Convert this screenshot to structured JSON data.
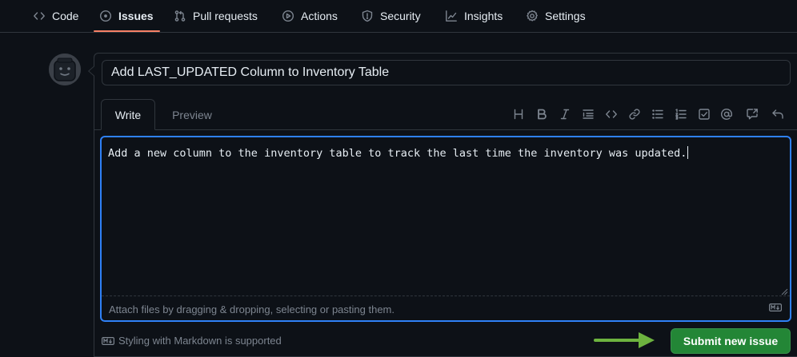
{
  "nav": {
    "items": [
      {
        "label": "Code",
        "icon": "code-icon"
      },
      {
        "label": "Issues",
        "icon": "issue-opened-icon",
        "active": true
      },
      {
        "label": "Pull requests",
        "icon": "git-pull-request-icon"
      },
      {
        "label": "Actions",
        "icon": "play-icon"
      },
      {
        "label": "Security",
        "icon": "shield-icon"
      },
      {
        "label": "Insights",
        "icon": "graph-icon"
      },
      {
        "label": "Settings",
        "icon": "gear-icon"
      }
    ]
  },
  "issue": {
    "title_value": "Add LAST_UPDATED Column to Inventory Table",
    "tabs": {
      "write": "Write",
      "preview": "Preview"
    },
    "toolbar": [
      "heading-icon",
      "bold-icon",
      "italic-icon",
      "quote-icon",
      "code-icon",
      "link-icon",
      "unordered-list-icon",
      "ordered-list-icon",
      "tasklist-icon",
      "mention-icon",
      "cross-reference-icon",
      "undo-icon"
    ],
    "body": "Add a new column to the inventory table to track the last time the inventory was updated.",
    "attach_hint": "Attach files by dragging & dropping, selecting or pasting them.",
    "markdown_note": "Styling with Markdown is supported",
    "submit_label": "Submit new issue"
  },
  "colors": {
    "background": "#0d1117",
    "border": "#30363d",
    "accent_focus": "#2f81f7",
    "tab_underline": "#f78166",
    "submit_green": "#238636",
    "pointer_arrow": "#6db33f"
  }
}
